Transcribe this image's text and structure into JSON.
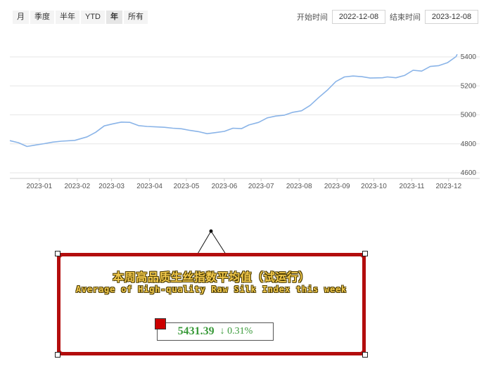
{
  "range_tabs": [
    {
      "label": "月",
      "active": false
    },
    {
      "label": "季度",
      "active": false
    },
    {
      "label": "半年",
      "active": false
    },
    {
      "label": "YTD",
      "active": false
    },
    {
      "label": "年",
      "active": true
    },
    {
      "label": "所有",
      "active": false
    }
  ],
  "date_range": {
    "start_label": "开始时间",
    "start_value": "2022-12-08",
    "end_label": "结束时间",
    "end_value": "2023-12-08"
  },
  "chart_data": {
    "type": "line",
    "line_color": "#8ab4e8",
    "x_tick_labels": [
      "2023-01",
      "2023-02",
      "2023-03",
      "2023-04",
      "2023-05",
      "2023-06",
      "2023-07",
      "2023-08",
      "2023-09",
      "2023-10",
      "2023-11",
      "2023-12"
    ],
    "y_ticks": [
      4600,
      4800,
      5000,
      5200,
      5400
    ],
    "ylim": [
      4600,
      5430
    ],
    "xlim": [
      "2022-12-08",
      "2023-12-08"
    ],
    "grid": true,
    "series": [
      {
        "points": [
          [
            "2022-12-08",
            4822
          ],
          [
            "2022-12-15",
            4808
          ],
          [
            "2022-12-22",
            4782
          ],
          [
            "2022-12-29",
            4792
          ],
          [
            "2023-01-05",
            4801
          ],
          [
            "2023-01-12",
            4812
          ],
          [
            "2023-01-19",
            4818
          ],
          [
            "2023-01-30",
            4824
          ],
          [
            "2023-02-09",
            4848
          ],
          [
            "2023-02-16",
            4880
          ],
          [
            "2023-02-23",
            4924
          ],
          [
            "2023-03-02",
            4938
          ],
          [
            "2023-03-09",
            4950
          ],
          [
            "2023-03-16",
            4948
          ],
          [
            "2023-03-23",
            4926
          ],
          [
            "2023-03-30",
            4920
          ],
          [
            "2023-04-06",
            4917
          ],
          [
            "2023-04-13",
            4914
          ],
          [
            "2023-04-20",
            4908
          ],
          [
            "2023-04-27",
            4904
          ],
          [
            "2023-05-04",
            4893
          ],
          [
            "2023-05-11",
            4884
          ],
          [
            "2023-05-18",
            4870
          ],
          [
            "2023-05-25",
            4878
          ],
          [
            "2023-06-01",
            4886
          ],
          [
            "2023-06-08",
            4908
          ],
          [
            "2023-06-15",
            4905
          ],
          [
            "2023-06-21",
            4930
          ],
          [
            "2023-06-29",
            4948
          ],
          [
            "2023-07-06",
            4979
          ],
          [
            "2023-07-13",
            4992
          ],
          [
            "2023-07-20",
            4998
          ],
          [
            "2023-07-27",
            5018
          ],
          [
            "2023-08-03",
            5028
          ],
          [
            "2023-08-10",
            5065
          ],
          [
            "2023-08-17",
            5120
          ],
          [
            "2023-08-24",
            5170
          ],
          [
            "2023-08-31",
            5230
          ],
          [
            "2023-09-07",
            5262
          ],
          [
            "2023-09-14",
            5268
          ],
          [
            "2023-09-21",
            5264
          ],
          [
            "2023-09-28",
            5254
          ],
          [
            "2023-10-08",
            5256
          ],
          [
            "2023-10-12",
            5262
          ],
          [
            "2023-10-19",
            5256
          ],
          [
            "2023-10-26",
            5272
          ],
          [
            "2023-11-02",
            5308
          ],
          [
            "2023-11-09",
            5302
          ],
          [
            "2023-11-16",
            5334
          ],
          [
            "2023-11-23",
            5340
          ],
          [
            "2023-11-30",
            5360
          ],
          [
            "2023-12-07",
            5402
          ],
          [
            "2023-12-08",
            5418
          ]
        ]
      }
    ]
  },
  "card": {
    "title_cn": "本周高品质生丝指数平均值（试运行）",
    "title_en": "Average of High-quality Raw Silk Index this week",
    "value": "5431.39",
    "change": "↓ 0.31%",
    "border_color": "#b30d0d",
    "value_color": "#3a9a3a",
    "title_color": "#f2c94c"
  }
}
